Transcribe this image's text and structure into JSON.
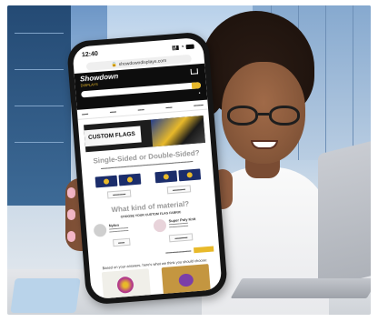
{
  "status_bar": {
    "time": "12:40"
  },
  "browser": {
    "url": "showdowndisplays.com"
  },
  "site": {
    "logo": "Showdown",
    "logo_sub": "DISPLAYS",
    "banner_title": "CUSTOM FLAGS",
    "single_double_heading": "Single-Sided or Double-Sided?",
    "material_heading": "What kind of material?",
    "material_choose": "CHOOSE YOUR CUSTOM FLAG FABRIC",
    "materials": [
      {
        "name": "Nylon"
      },
      {
        "name": "Super Poly Knit"
      }
    ],
    "bottom_question": "Based on your answers, here's what we think you should choose:"
  }
}
